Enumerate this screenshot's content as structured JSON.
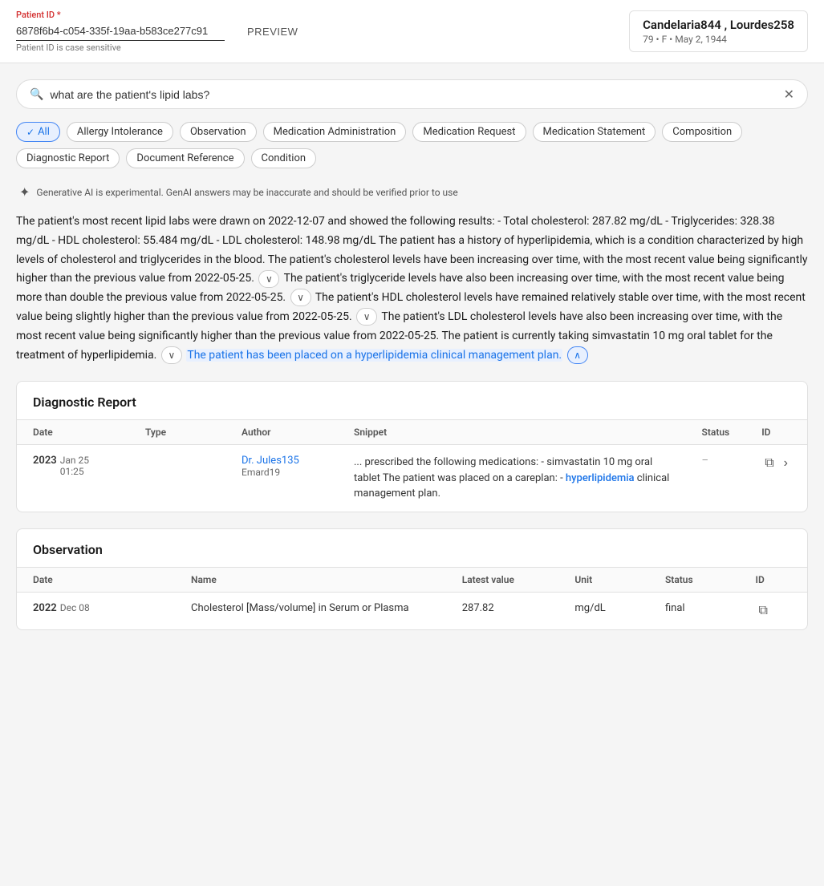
{
  "header": {
    "patient_id_label": "Patient ID",
    "required_marker": "*",
    "patient_id_value": "6878f6b4-c054-335f-19aa-b583ce277c91",
    "patient_id_hint": "Patient ID is case sensitive",
    "preview_label": "PREVIEW",
    "patient_name": "Candelaria844 , Lourdes258",
    "patient_details": "79 • F • May 2, 1944"
  },
  "search": {
    "placeholder": "what are the patient's lipid labs?",
    "current_value": "what are the patient's lipid labs?",
    "clear_icon": "✕"
  },
  "filters": {
    "items": [
      {
        "id": "all",
        "label": "All",
        "active": true
      },
      {
        "id": "allergy-intolerance",
        "label": "Allergy Intolerance",
        "active": false
      },
      {
        "id": "observation",
        "label": "Observation",
        "active": false
      },
      {
        "id": "medication-administration",
        "label": "Medication Administration",
        "active": false
      },
      {
        "id": "medication-request",
        "label": "Medication Request",
        "active": false
      },
      {
        "id": "medication-statement",
        "label": "Medication Statement",
        "active": false
      },
      {
        "id": "composition",
        "label": "Composition",
        "active": false
      },
      {
        "id": "diagnostic-report",
        "label": "Diagnostic Report",
        "active": false
      },
      {
        "id": "document-reference",
        "label": "Document Reference",
        "active": false
      },
      {
        "id": "condition",
        "label": "Condition",
        "active": false
      }
    ]
  },
  "ai_disclaimer": "Generative AI is experimental. GenAI answers may be inaccurate and should be verified prior to use",
  "ai_response": {
    "text_before_expand1": "The patient's most recent lipid labs were drawn on 2022-12-07 and showed the following results: - Total cholesterol: 287.82 mg/dL - Triglycerides: 328.38 mg/dL - HDL cholesterol: 55.484 mg/dL - LDL cholesterol: 148.98 mg/dL The patient has a history of hyperlipidemia, which is a condition characterized by high levels of cholesterol and triglycerides in the blood. The patient's cholesterol levels have been increasing over time, with the most recent value being significantly higher than the previous value from 2022-05-25.",
    "text_before_expand2": "The patient's triglyceride levels have also been increasing over time, with the most recent value being more than double the previous value from 2022-05-25.",
    "text_before_expand3": "The patient's HDL cholesterol levels have remained relatively stable over time, with the most recent value being slightly higher than the previous value from 2022-05-25.",
    "text_before_expand4": "The patient's LDL cholesterol levels have also been increasing over time, with the most recent value being significantly higher than the previous value from 2022-05-25. The patient is currently taking simvastatin 10 mg oral tablet for the treatment of hyperlipidemia.",
    "highlighted_text": "The patient has been placed on a hyperlipidemia clinical management plan."
  },
  "diagnostic_report": {
    "section_title": "Diagnostic Report",
    "columns": {
      "date": "Date",
      "type": "Type",
      "author": "Author",
      "snippet": "Snippet",
      "status": "Status",
      "id": "ID"
    },
    "rows": [
      {
        "date_year": "2023",
        "date_rest": "Jan  25  01:25",
        "type": "",
        "author_name": "Dr. Jules135",
        "author_sub": "Emard19",
        "snippet_before": "... prescribed the following medications: - simvastatin 10 mg oral tablet The patient was placed on a careplan: -",
        "snippet_highlight": "hyperlipidemia",
        "snippet_after": " clinical management plan.",
        "status": "–",
        "id": ""
      }
    ]
  },
  "observation": {
    "section_title": "Observation",
    "columns": {
      "date": "Date",
      "name": "Name",
      "latest_value": "Latest value",
      "unit": "Unit",
      "status": "Status",
      "id": "ID"
    },
    "rows": [
      {
        "date_year": "2022",
        "date_rest": "Dec  08",
        "name": "Cholesterol [Mass/volume] in Serum or Plasma",
        "latest_value": "287.82",
        "unit": "mg/dL",
        "status": "final",
        "id": ""
      }
    ]
  },
  "icons": {
    "search": "🔍",
    "clear": "✕",
    "ai_spark": "✦",
    "expand_down": "∨",
    "expand_up": "∧",
    "copy": "⧉",
    "chevron_down": "›",
    "copy_id": "⧉"
  }
}
